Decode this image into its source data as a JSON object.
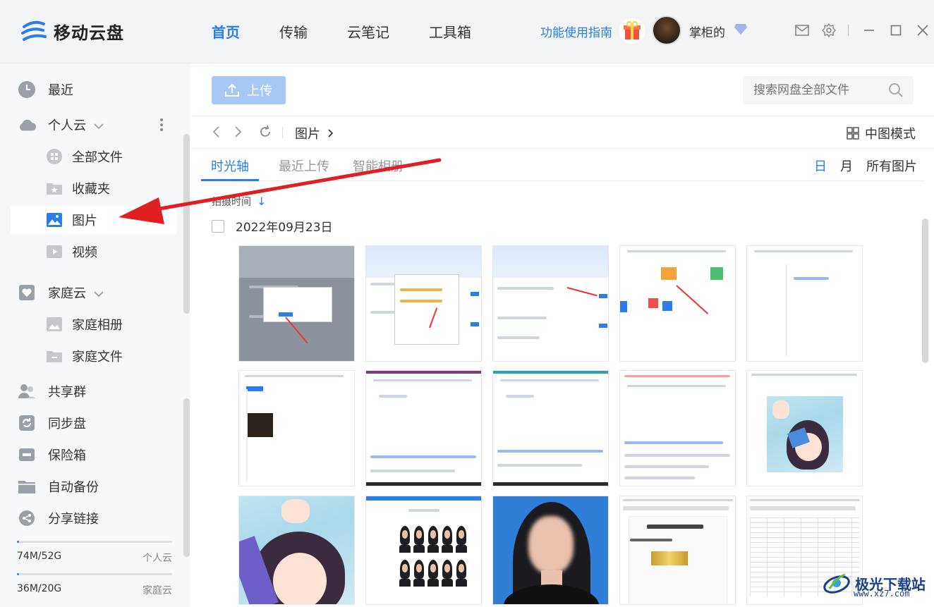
{
  "app": {
    "name": "移动云盘"
  },
  "nav": {
    "items": [
      "首页",
      "传输",
      "云笔记",
      "工具箱"
    ],
    "active": "首页"
  },
  "header": {
    "guide": "功能使用指南",
    "username": "掌柜的"
  },
  "sidebar": {
    "recent": "最近",
    "personal_cloud": "个人云",
    "all_files": "全部文件",
    "favorites": "收藏夹",
    "pictures": "图片",
    "videos": "视频",
    "family_cloud": "家庭云",
    "family_album": "家庭相册",
    "family_files": "家庭文件",
    "share_group": "共享群",
    "sync_disk": "同步盘",
    "safe_box": "保险箱",
    "auto_backup": "自动备份",
    "share_link": "分享链接"
  },
  "quota": [
    {
      "used": "74M/52G",
      "name": "个人云",
      "fraction": 0.0014
    },
    {
      "used": "36M/20G",
      "name": "家庭云",
      "fraction": 0.0018
    }
  ],
  "toolbar": {
    "upload": "上传",
    "search_placeholder": "搜索网盘全部文件"
  },
  "breadcrumb": {
    "current": "图片"
  },
  "view_mode": "中图模式",
  "tabs": {
    "timeline": "时光轴",
    "recent_upload": "最近上传",
    "smart_album": "智能相册"
  },
  "range": {
    "day": "日",
    "month": "月",
    "all": "所有图片"
  },
  "sort_label": "拍摄时间",
  "date_group": "2022年09月23日",
  "watermark": {
    "title": "极光下载站",
    "url": "www.xz7.com"
  },
  "colors": {
    "accent": "#2b7de9",
    "arrow": "#e02020"
  }
}
